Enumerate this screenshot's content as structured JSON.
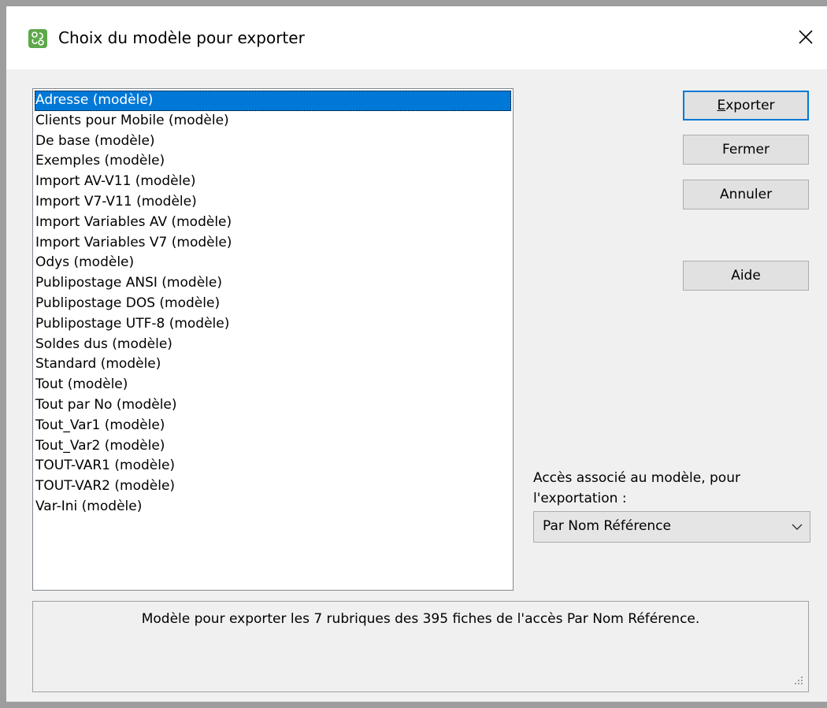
{
  "window": {
    "title": "Choix du modèle pour exporter",
    "icon": "app-logo-icon",
    "close_icon": "close-icon"
  },
  "models": [
    {
      "label": "Adresse (modèle)",
      "selected": true
    },
    {
      "label": "Clients pour Mobile (modèle)",
      "selected": false
    },
    {
      "label": "De base (modèle)",
      "selected": false
    },
    {
      "label": "Exemples (modèle)",
      "selected": false
    },
    {
      "label": "Import AV-V11 (modèle)",
      "selected": false
    },
    {
      "label": "Import V7-V11 (modèle)",
      "selected": false
    },
    {
      "label": "Import Variables AV (modèle)",
      "selected": false
    },
    {
      "label": "Import Variables V7 (modèle)",
      "selected": false
    },
    {
      "label": "Odys (modèle)",
      "selected": false
    },
    {
      "label": "Publipostage ANSI (modèle)",
      "selected": false
    },
    {
      "label": "Publipostage DOS (modèle)",
      "selected": false
    },
    {
      "label": "Publipostage UTF-8 (modèle)",
      "selected": false
    },
    {
      "label": "Soldes dus (modèle)",
      "selected": false
    },
    {
      "label": "Standard (modèle)",
      "selected": false
    },
    {
      "label": "Tout (modèle)",
      "selected": false
    },
    {
      "label": "Tout par No (modèle)",
      "selected": false
    },
    {
      "label": "Tout_Var1 (modèle)",
      "selected": false
    },
    {
      "label": "Tout_Var2 (modèle)",
      "selected": false
    },
    {
      "label": "TOUT-VAR1 (modèle)",
      "selected": false
    },
    {
      "label": "TOUT-VAR2 (modèle)",
      "selected": false
    },
    {
      "label": "Var-Ini (modèle)",
      "selected": false
    }
  ],
  "buttons": {
    "export_mnemonic": "E",
    "export_rest": "xporter",
    "close": "Fermer",
    "cancel": "Annuler",
    "help": "Aide"
  },
  "access": {
    "label": "Accès associé au modèle, pour l'exportation :",
    "selected": "Par Nom Référence",
    "chevron_icon": "chevron-down-icon"
  },
  "status": {
    "text": "Modèle pour exporter les 7 rubriques  des 395 fiches de l'accès  Par Nom Référence."
  },
  "colors": {
    "selection": "#0078d7",
    "dialog_bg": "#f0f0f0",
    "button_bg": "#e1e1e1",
    "app_icon": "#5da84a"
  }
}
